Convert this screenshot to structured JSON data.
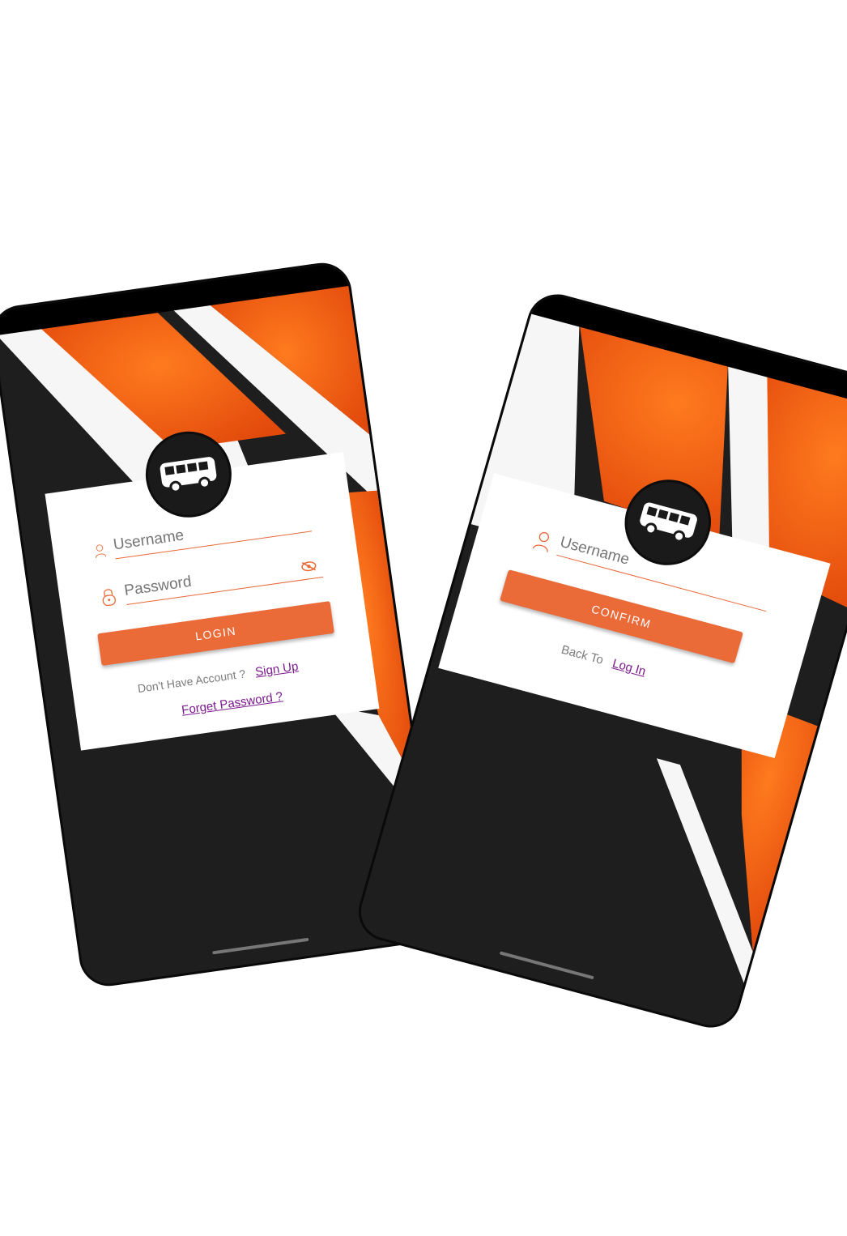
{
  "login_screen": {
    "username_placeholder": "Username",
    "password_placeholder": "Password",
    "login_button": "LOGIN",
    "no_account_text": "Don't Have Account ?",
    "sign_up_link": "Sign Up",
    "forget_password_link": "Forget Password ?"
  },
  "reset_screen": {
    "username_placeholder": "Username",
    "confirm_button": "CONFIRM",
    "back_to_text": "Back To",
    "log_in_link": "Log In"
  },
  "icons": [
    "bus-icon",
    "user-icon",
    "lock-icon",
    "eye-off-icon"
  ],
  "colors": {
    "accent": "#ea6a38",
    "orange_art": "#f05a12",
    "dark_bg": "#1e1e1e",
    "link": "#7a1a8c"
  }
}
